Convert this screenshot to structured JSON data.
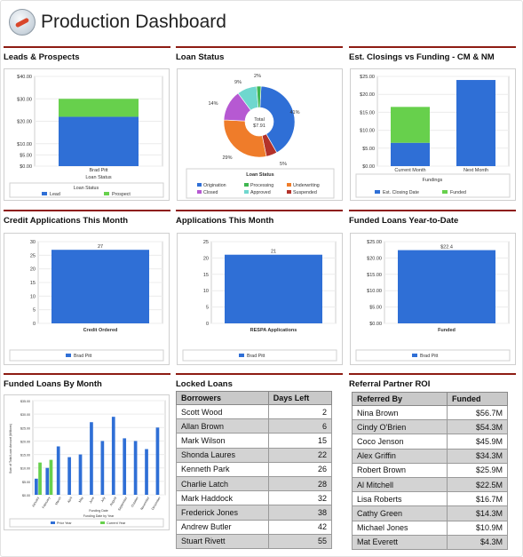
{
  "header": {
    "title": "Production Dashboard",
    "logo_icon": "dial-icon"
  },
  "panels": {
    "leads": {
      "title": "Leads & Prospects",
      "chart_data": {
        "type": "bar",
        "stacked": true,
        "categories": [
          "Brad Pitt"
        ],
        "series": [
          {
            "name": "Lead",
            "values": [
              22
            ],
            "color": "#2f6fd6"
          },
          {
            "name": "Prospect",
            "values": [
              8
            ],
            "color": "#67d04c"
          }
        ],
        "yticks": [
          "$0.00",
          "$5.00",
          "$10.00",
          "$20.00",
          "$30.00",
          "$40.00"
        ],
        "ylim": [
          0,
          40
        ],
        "xlabel": "Loan Status",
        "legend_title": "Loan Status",
        "legend": [
          "Lead",
          "Prospect"
        ]
      }
    },
    "loan_status": {
      "title": "Loan Status",
      "chart_data": {
        "type": "pie",
        "center_label": "Total",
        "center_value": "$7.91",
        "slices": [
          {
            "name": "Origination",
            "value": 41,
            "label": "41%",
            "color": "#2f6fd6"
          },
          {
            "name": "Suspended",
            "value": 5,
            "label": "5%",
            "color": "#b3322a"
          },
          {
            "name": "Underwriting",
            "value": 29,
            "label": "29%",
            "color": "#ef7c2a"
          },
          {
            "name": "Closed",
            "value": 14,
            "label": "14%",
            "color": "#b659d2"
          },
          {
            "name": "Approved",
            "value": 9,
            "label": "9%",
            "color": "#6fd7ce"
          },
          {
            "name": "Processing",
            "value": 2,
            "label": "2%",
            "color": "#3fb650"
          }
        ],
        "legend_title": "Loan Status",
        "legend": [
          {
            "name": "Origination",
            "color": "#2f6fd6"
          },
          {
            "name": "Processing",
            "color": "#3fb650"
          },
          {
            "name": "Underwriting",
            "color": "#ef7c2a"
          },
          {
            "name": "Closed",
            "color": "#b659d2"
          },
          {
            "name": "Approved",
            "color": "#6fd7ce"
          },
          {
            "name": "Suspended",
            "color": "#b3322a"
          }
        ]
      }
    },
    "closings": {
      "title": "Est. Closings vs Funding - CM & NM",
      "chart_data": {
        "type": "bar",
        "stacked": true,
        "categories": [
          "Current Month",
          "Next Month"
        ],
        "series": [
          {
            "name": "Est. Closing Date",
            "values": [
              6.5,
              24
            ],
            "color": "#2f6fd6"
          },
          {
            "name": "Funded",
            "values": [
              10,
              0
            ],
            "color": "#67d04c"
          }
        ],
        "yticks": [
          "$0.00",
          "$5.00",
          "$10.00",
          "$15.00",
          "$20.00",
          "$25.00"
        ],
        "ylim": [
          0,
          25
        ],
        "legend_title": "Fundings",
        "legend": [
          "Est. Closing Date",
          "Funded"
        ]
      }
    },
    "credit": {
      "title": "Credit Applications This Month",
      "chart_data": {
        "type": "bar",
        "categories": [
          "Brad Pitt"
        ],
        "values": [
          27
        ],
        "value_label": "27",
        "yticks": [
          "0",
          "5",
          "10",
          "15",
          "20",
          "25",
          "30"
        ],
        "ylim": [
          0,
          30
        ],
        "xlabel": "Credit Ordered",
        "legend": [
          "Brad Pitt"
        ]
      }
    },
    "applications": {
      "title": "Applications This Month",
      "chart_data": {
        "type": "bar",
        "categories": [
          "Brad Pitt"
        ],
        "values": [
          21
        ],
        "value_label": "21",
        "yticks": [
          "0",
          "5",
          "10",
          "15",
          "20",
          "25"
        ],
        "ylim": [
          0,
          25
        ],
        "xlabel": "RESPA Applications",
        "legend": [
          "Brad Pitt"
        ]
      }
    },
    "funded_ytd": {
      "title": "Funded Loans Year-to-Date",
      "chart_data": {
        "type": "bar",
        "categories": [
          "Brad Pitt"
        ],
        "values": [
          22.4
        ],
        "value_label": "$22.4",
        "yticks": [
          "$0.00",
          "$5.00",
          "$10.00",
          "$15.00",
          "$20.00",
          "$25.00"
        ],
        "ylim": [
          0,
          25
        ],
        "xlabel": "Funded",
        "legend": [
          "Brad Pitt"
        ]
      }
    },
    "funded_month": {
      "title": "Funded Loans By Month",
      "chart_data": {
        "type": "bar",
        "categories": [
          "January",
          "February",
          "March",
          "April",
          "May",
          "June",
          "July",
          "August",
          "September",
          "October",
          "November",
          "December"
        ],
        "series": [
          {
            "name": "Prior Year",
            "values": [
              6,
              10,
              18,
              14,
              15,
              27,
              20,
              29,
              21,
              20,
              17,
              25
            ],
            "color": "#2f6fd6"
          },
          {
            "name": "Current Year",
            "values": [
              12,
              13,
              0,
              0,
              0,
              0,
              0,
              0,
              0,
              0,
              0,
              0
            ],
            "color": "#67d04c"
          }
        ],
        "yticks": [
          "$0.00",
          "$5.00",
          "$10.00",
          "$15.00",
          "$20.00",
          "$25.00",
          "$30.00",
          "$35.00"
        ],
        "ylim": [
          0,
          35
        ],
        "ylabel": "Sum of Total Loan Amount (Millions)",
        "xlabel": "Funding Date",
        "xlabel2": "Funding Date by Year",
        "legend": [
          "Prior Year",
          "Current Year"
        ]
      }
    },
    "locked": {
      "title": "Locked Loans",
      "columns": [
        "Borrowers",
        "Days Left"
      ],
      "rows": [
        [
          "Scott Wood",
          "2"
        ],
        [
          "Allan Brown",
          "6"
        ],
        [
          "Mark Wilson",
          "15"
        ],
        [
          "Shonda Laures",
          "22"
        ],
        [
          "Kenneth Park",
          "26"
        ],
        [
          "Charlie Latch",
          "28"
        ],
        [
          "Mark Haddock",
          "32"
        ],
        [
          "Frederick Jones",
          "38"
        ],
        [
          "Andrew Butler",
          "42"
        ],
        [
          "Stuart Rivett",
          "55"
        ]
      ]
    },
    "referral": {
      "title": "Referral Partner ROI",
      "columns": [
        "Referred By",
        "Funded"
      ],
      "rows": [
        [
          "Nina Brown",
          "$56.7M"
        ],
        [
          "Cindy O'Brien",
          "$54.3M"
        ],
        [
          "Coco Jenson",
          "$45.9M"
        ],
        [
          "Alex Griffin",
          "$34.3M"
        ],
        [
          "Robert Brown",
          "$25.9M"
        ],
        [
          "Al Mitchell",
          "$22.5M"
        ],
        [
          "Lisa Roberts",
          "$16.7M"
        ],
        [
          "Cathy Green",
          "$14.3M"
        ],
        [
          "Michael Jones",
          "$10.9M"
        ],
        [
          "Mat Everett",
          "$4.3M"
        ]
      ]
    }
  }
}
